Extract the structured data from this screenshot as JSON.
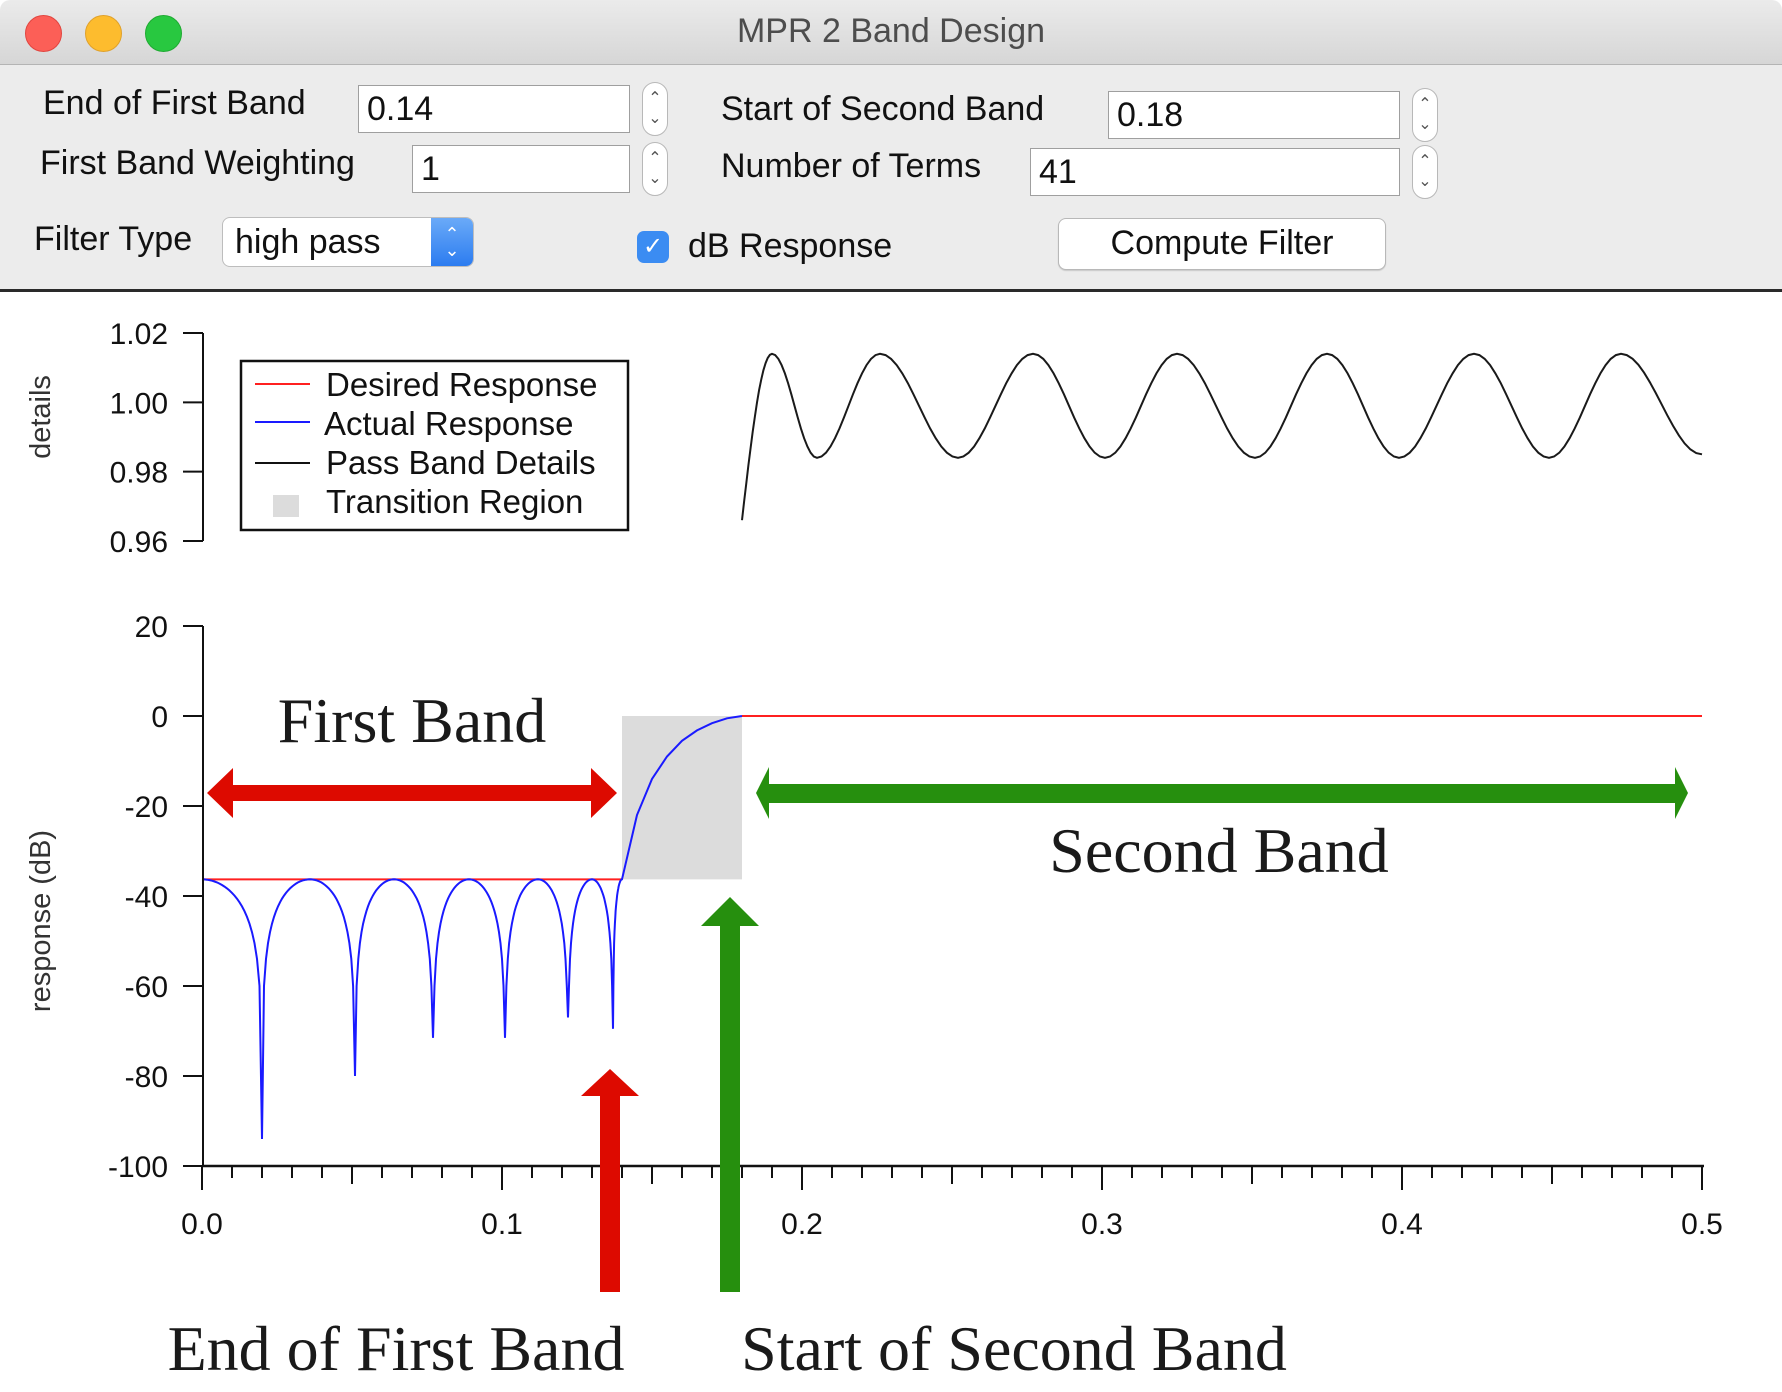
{
  "window": {
    "title": "MPR 2 Band Design"
  },
  "controls": {
    "end_first_band": {
      "label": "End of First Band",
      "value": "0.14"
    },
    "first_band_weighting": {
      "label": "First Band Weighting",
      "value": "1"
    },
    "filter_type": {
      "label": "Filter Type",
      "value": "high pass"
    },
    "start_second_band": {
      "label": "Start of Second Band",
      "value": "0.18"
    },
    "number_of_terms": {
      "label": "Number of Terms",
      "value": "41"
    },
    "db_response": {
      "label": "dB Response",
      "checked": true
    },
    "compute_button": "Compute Filter"
  },
  "colors": {
    "desired": "#ff2020",
    "actual": "#1a1aff",
    "details": "#1a1a1a",
    "transition": "#dcdcdc",
    "annotation_red": "#dd0a00",
    "annotation_green": "#268f0e"
  },
  "annotations": {
    "first_band": "First Band",
    "second_band": "Second Band",
    "end_first_band": "End of First Band",
    "start_second_band": "Start of Second Band"
  },
  "chart_data": [
    {
      "type": "line",
      "name": "details",
      "ylabel": "details",
      "ylim": [
        0.96,
        1.02
      ],
      "yticks": [
        "1.02",
        "1.00",
        "0.98",
        "0.96"
      ],
      "xlim": [
        0,
        0.5
      ],
      "legend": {
        "placement": "top-left",
        "entries": [
          "Desired Response",
          "Actual Response",
          "Pass Band Details",
          "Transition Region"
        ]
      },
      "series": [
        {
          "name": "Pass Band Details",
          "x": [
            0.18,
            0.19,
            0.205,
            0.226,
            0.252,
            0.277,
            0.301,
            0.325,
            0.351,
            0.375,
            0.399,
            0.424,
            0.449,
            0.473,
            0.5
          ],
          "y": [
            0.966,
            1.014,
            0.984,
            1.014,
            0.984,
            1.014,
            0.984,
            1.014,
            0.984,
            1.014,
            0.984,
            1.014,
            0.984,
            1.014,
            0.985
          ]
        }
      ]
    },
    {
      "type": "line",
      "name": "response",
      "ylabel": "response (dB)",
      "xlabel": "",
      "xlim": [
        0,
        0.5
      ],
      "ylim": [
        -100,
        20
      ],
      "xticks": [
        "0.0",
        "0.1",
        "0.2",
        "0.3",
        "0.4",
        "0.5"
      ],
      "yticks": [
        "20",
        "0",
        "-20",
        "-40",
        "-60",
        "-80",
        "-100"
      ],
      "series": [
        {
          "name": "Desired Response",
          "segments": [
            {
              "x": [
                0,
                0.14
              ],
              "y": [
                -36.3,
                -36.3
              ]
            },
            {
              "x": [
                0.18,
                0.5
              ],
              "y": [
                0,
                0
              ]
            }
          ]
        },
        {
          "name": "Actual Response",
          "stopband_peak_db": -36.3,
          "nulls": [
            {
              "x": 0.02,
              "y": -94
            },
            {
              "x": 0.051,
              "y": -80
            },
            {
              "x": 0.077,
              "y": -71.5
            },
            {
              "x": 0.101,
              "y": -71.5
            },
            {
              "x": 0.122,
              "y": -67
            },
            {
              "x": 0.137,
              "y": -69.5
            }
          ],
          "peaks_x": [
            0,
            0.036,
            0.064,
            0.089,
            0.112,
            0.13,
            0.14
          ],
          "transition": {
            "x": [
              0.14,
              0.145,
              0.15,
              0.155,
              0.16,
              0.165,
              0.17,
              0.175,
              0.18
            ],
            "y": [
              -36.3,
              -22,
              -14,
              -9,
              -5.5,
              -3.2,
              -1.6,
              -0.5,
              0
            ]
          }
        },
        {
          "name": "Transition Region",
          "x": [
            0.14,
            0.18
          ],
          "y": [
            -36.3,
            0
          ]
        }
      ]
    }
  ]
}
